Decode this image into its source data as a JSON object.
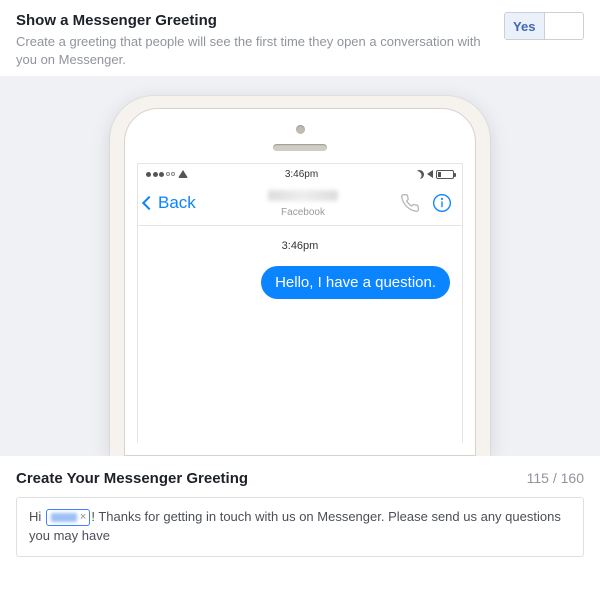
{
  "header": {
    "title": "Show a Messenger Greeting",
    "subtitle": "Create a greeting that people will see the first time they open a conversation with you on Messenger.",
    "toggle_yes": "Yes",
    "toggle_no": ""
  },
  "phone": {
    "status_time": "3:46pm",
    "back_label": "Back",
    "page_label": "Facebook",
    "chat_time": "3:46pm",
    "bubble_text": "Hello, I have a question."
  },
  "editor": {
    "title": "Create Your Messenger Greeting",
    "counter": "115 / 160",
    "text_before": "Hi ",
    "text_after": "! Thanks for getting in touch with us on Messenger. Please send us any questions you may have",
    "chip_remove": "×"
  }
}
